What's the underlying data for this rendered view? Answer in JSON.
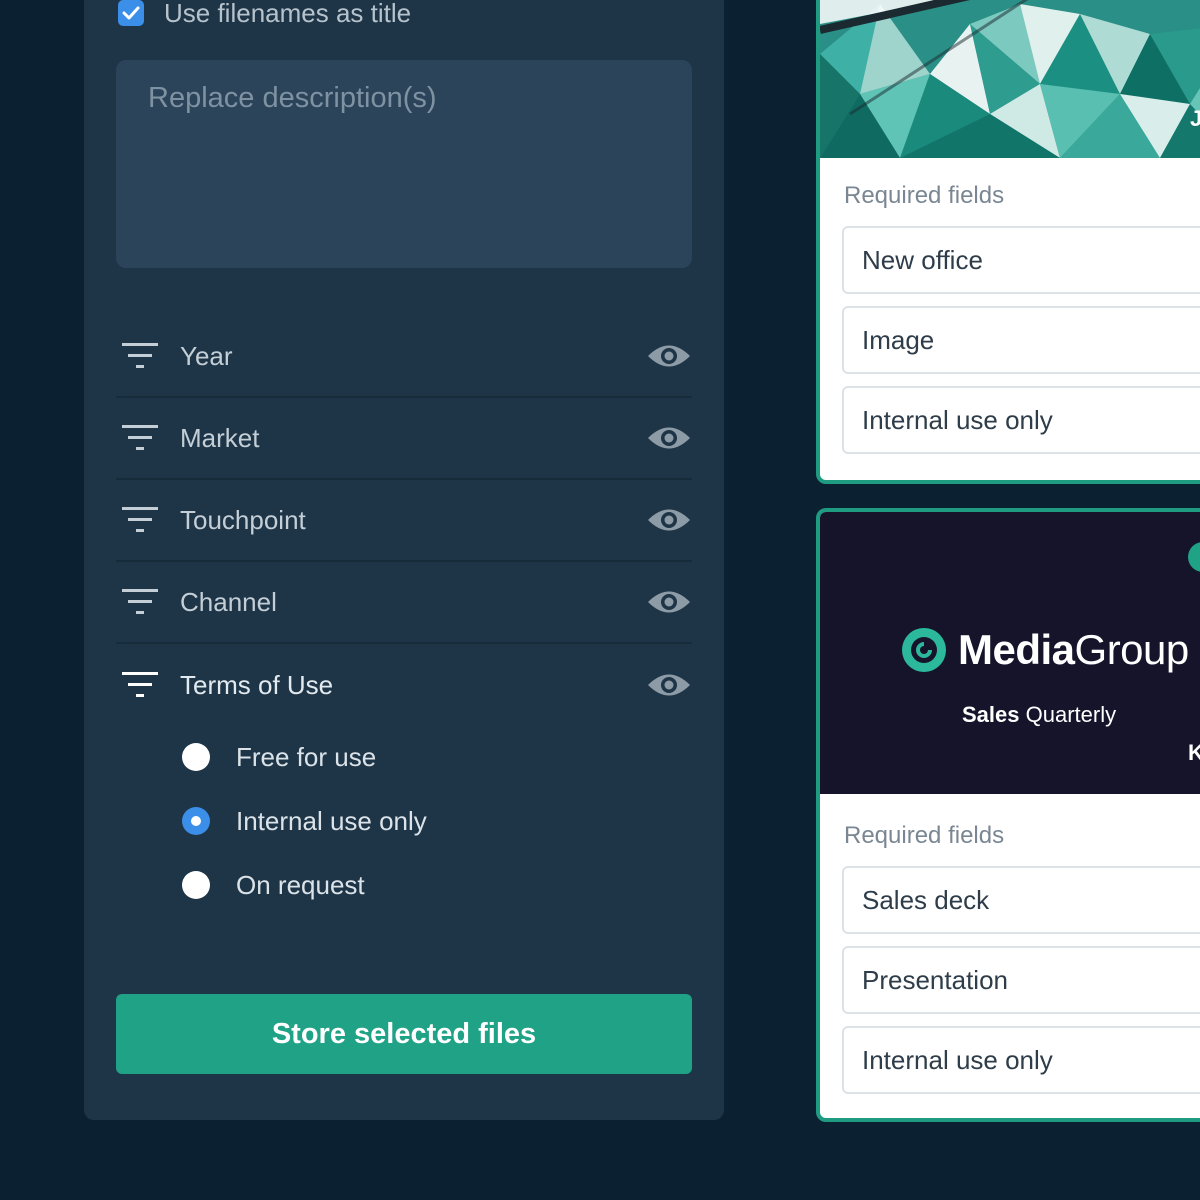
{
  "left_panel": {
    "use_filenames_label": "Use filenames as title",
    "use_filenames_checked": true,
    "description_placeholder": "Replace description(s)",
    "filters": [
      {
        "label": "Year",
        "icon": "eye-icon"
      },
      {
        "label": "Market",
        "icon": "eye-icon"
      },
      {
        "label": "Touchpoint",
        "icon": "eye-icon"
      },
      {
        "label": "Channel",
        "icon": "eye-icon"
      },
      {
        "label": "Terms of Use",
        "icon": "eye-icon"
      }
    ],
    "terms_options": [
      {
        "label": "Free for use",
        "selected": false
      },
      {
        "label": "Internal use only",
        "selected": true
      },
      {
        "label": "On request",
        "selected": false
      }
    ],
    "store_button_label": "Store selected files"
  },
  "cards": [
    {
      "image_edge_char": "J",
      "required_label": "Required fields",
      "fields": [
        "New office",
        "Image",
        "Internal use only"
      ]
    },
    {
      "brand_bold": "Media",
      "brand_regular": "Group",
      "subtitle_bold": "Sales",
      "subtitle_regular": "Quarterly",
      "image_edge_char": "K",
      "required_label": "Required fields",
      "fields": [
        "Sales deck",
        "Presentation",
        "Internal use only"
      ]
    }
  ],
  "colors": {
    "page_bg": "#0b2131",
    "panel_bg": "#1e3547",
    "accent_green": "#1fa286",
    "accent_blue": "#3b8fe8",
    "card_border": "#1f9b82"
  }
}
